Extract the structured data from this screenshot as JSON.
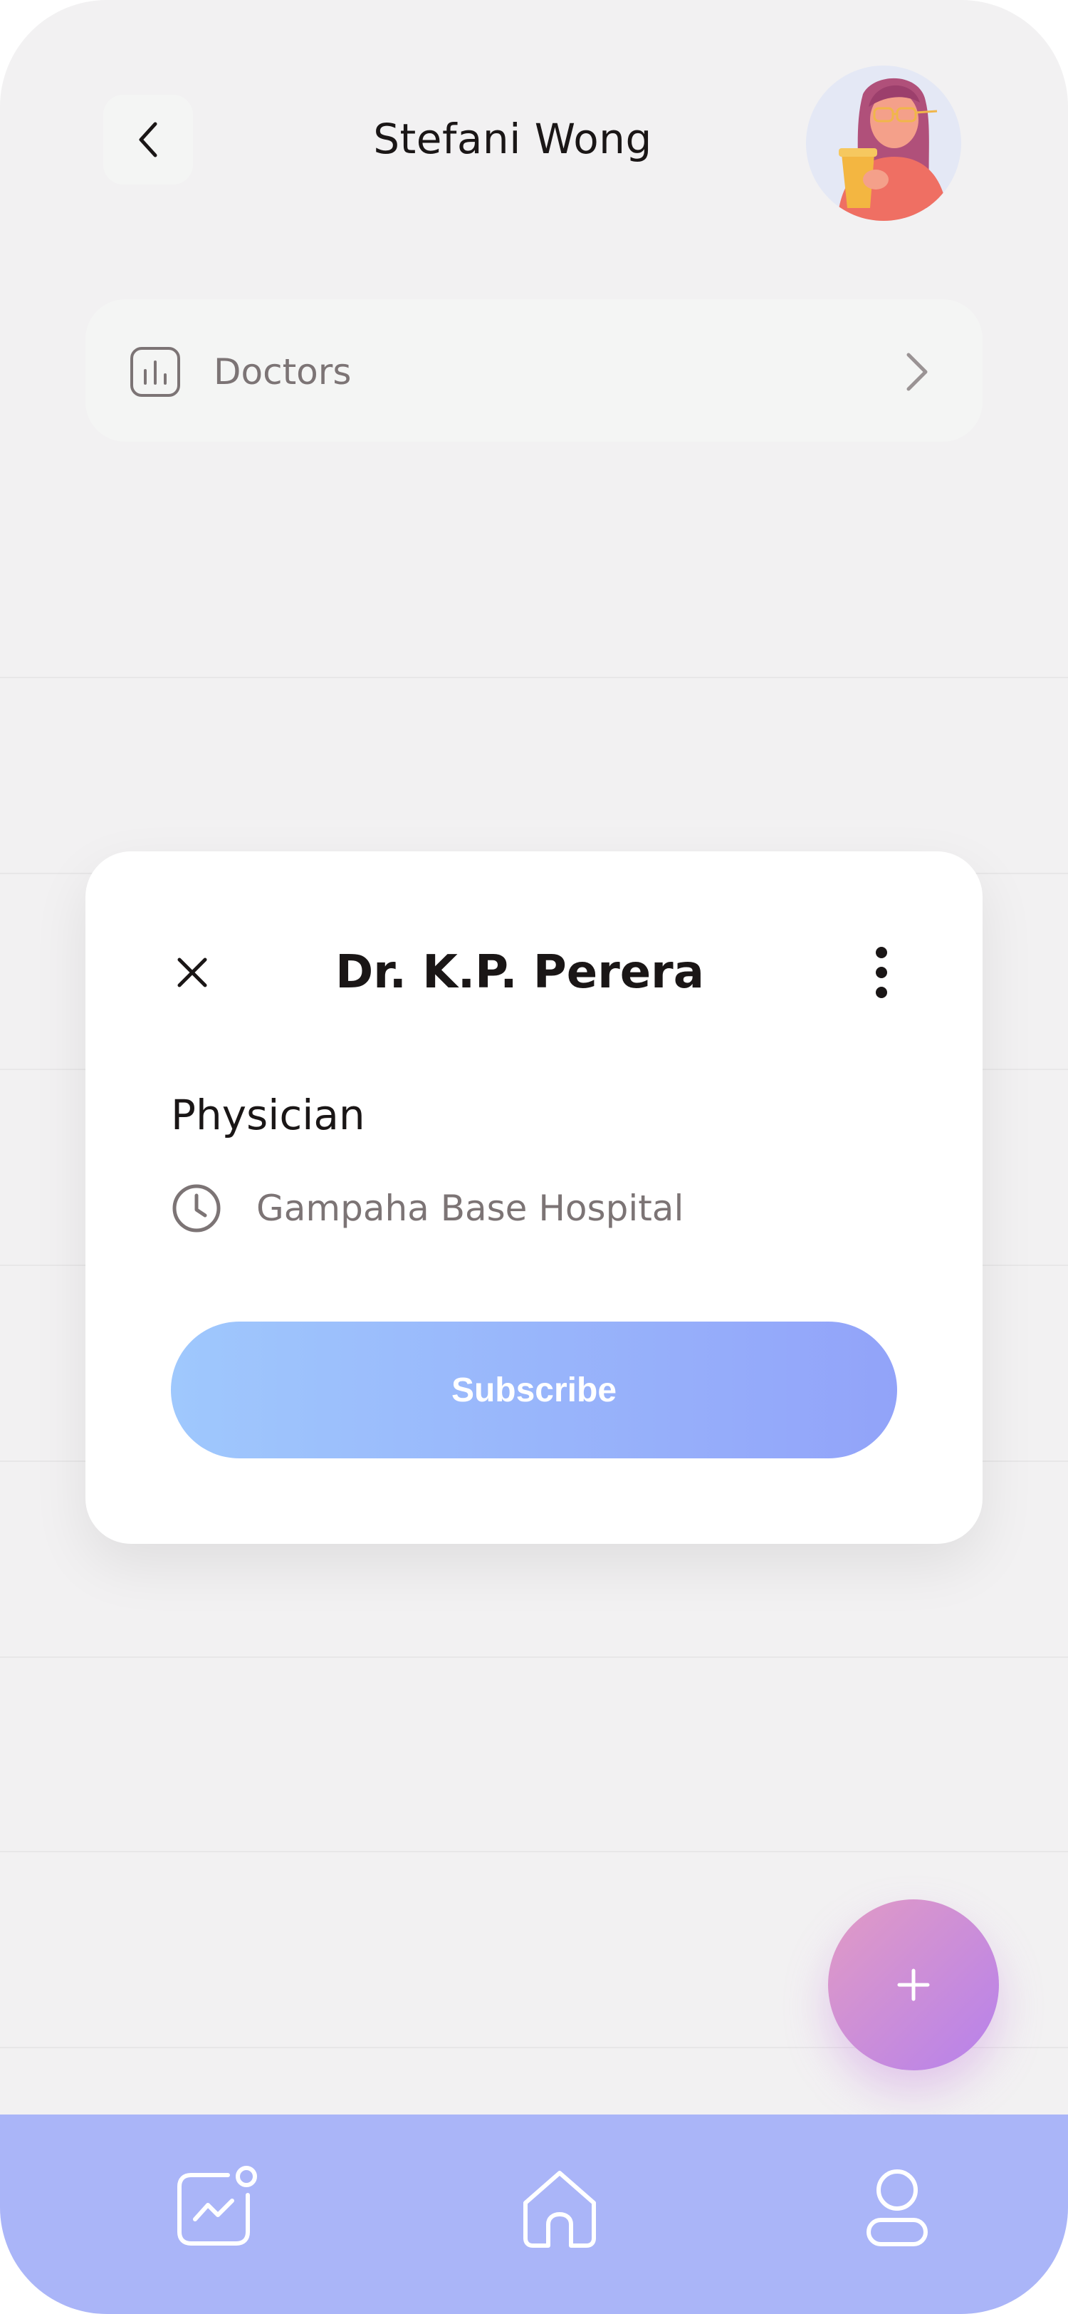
{
  "header": {
    "title": "Stefani Wong",
    "back_icon": "chevron-left-icon",
    "avatar": "user-avatar"
  },
  "category": {
    "label": "Doctors",
    "icon": "bar-chart-icon",
    "chevron": "chevron-right-icon"
  },
  "modal": {
    "title": "Dr. K.P. Perera",
    "specialty": "Physician",
    "hospital": "Gampaha Base Hospital",
    "subscribe_label": "Subscribe",
    "close_icon": "close-icon",
    "more_icon": "more-vertical-icon",
    "clock_icon": "clock-icon"
  },
  "fab": {
    "icon": "plus-icon"
  },
  "bottom_nav": {
    "items": [
      {
        "name": "activity",
        "icon": "chart-notification-icon"
      },
      {
        "name": "home",
        "icon": "home-icon"
      },
      {
        "name": "profile",
        "icon": "user-icon"
      }
    ]
  },
  "colors": {
    "background": "#f2f1f2",
    "card": "#f4f5f4",
    "nav": "#aab5f8",
    "subscribe_gradient_start": "#9fc8fd",
    "subscribe_gradient_end": "#92a3f9",
    "fab_gradient_start": "#e29bc4",
    "fab_gradient_end": "#b681ec",
    "title_text": "#1a1616",
    "muted_text": "#7c7475"
  }
}
